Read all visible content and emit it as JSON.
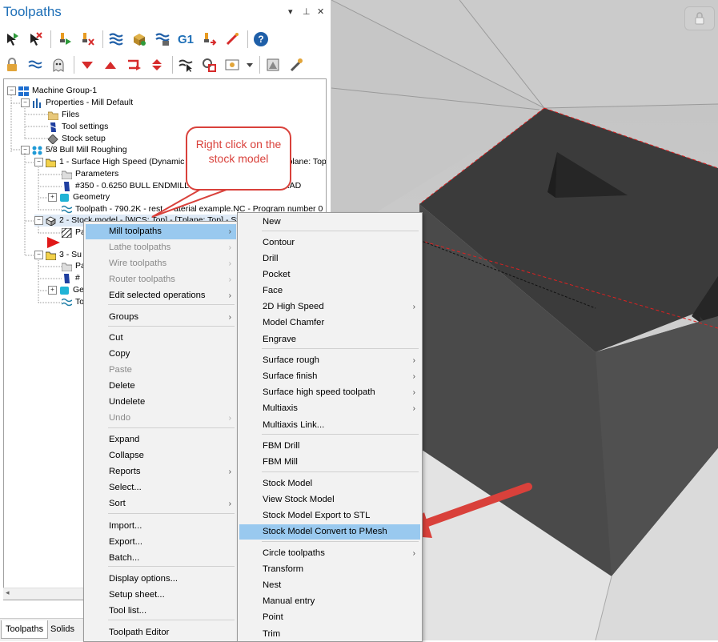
{
  "panel": {
    "title": "Toolpaths",
    "title_controls": [
      "▾",
      "⊥",
      "✕"
    ],
    "toolbar1_icons": [
      "select-all-icon",
      "deselect-icon",
      "regenerate-icon",
      "regenerate-dirty-icon",
      "backplot-icon",
      "verify-icon",
      "simulate-icon",
      "post-g1-icon",
      "post-selected-icon",
      "edit-tool-icon",
      "help-icon"
    ],
    "toolbar1_g1_label": "G1",
    "toolbar2_icons": [
      "lock-icon",
      "toggle-display-icon",
      "ghost-icon",
      "move-down-icon",
      "move-up-icon",
      "insert-arrow-icon",
      "move-updown-icon",
      "highlight-icon",
      "single-display-icon",
      "options-icon",
      "dropdown-icon",
      "verify-settings-icon",
      "wand-icon"
    ]
  },
  "tree": {
    "nodes": [
      {
        "text": "Machine Group-1"
      },
      {
        "text": "Properties - Mill Default"
      },
      {
        "text": "Files"
      },
      {
        "text": "Tool settings"
      },
      {
        "text": "Stock setup"
      },
      {
        "text": "5/8 Bull Mill Roughing"
      },
      {
        "text": "1 - Surface High Speed (Dynamic O"
      },
      {
        "text": "plane: Top]"
      },
      {
        "text": "Parameters"
      },
      {
        "text": "#350 - 0.6250 BULL ENDMILL - "
      },
      {
        "text": "RAD"
      },
      {
        "text": "Geometry"
      },
      {
        "text": "Toolpath - 790.2K - rest"
      },
      {
        "text": "aterial example.NC - Program number 0"
      },
      {
        "text": "2 - Stock model - [WCS: Top] - [Tplane: Top] - Sto"
      },
      {
        "text": "Pa"
      },
      {
        "text": "3 - Su"
      },
      {
        "text": "Pa"
      },
      {
        "text": "#"
      },
      {
        "text": "Ge"
      },
      {
        "text": "To"
      }
    ]
  },
  "tabs": [
    "Toolpaths",
    "Solids"
  ],
  "callout": {
    "text": "Right click on the stock model"
  },
  "context_menu": {
    "items": [
      {
        "label": "Mill toolpaths",
        "arrow": "›",
        "state": "highlight"
      },
      {
        "label": "Lathe toolpaths",
        "arrow": "›",
        "state": "disabled"
      },
      {
        "label": "Wire toolpaths",
        "arrow": "›",
        "state": "disabled"
      },
      {
        "label": "Router toolpaths",
        "arrow": "›",
        "state": "disabled"
      },
      {
        "label": "Edit selected operations",
        "arrow": "›",
        "state": "normal"
      },
      {
        "label": "Groups",
        "arrow": "›",
        "state": "normal"
      },
      {
        "label": "Cut",
        "arrow": "",
        "state": "normal"
      },
      {
        "label": "Copy",
        "arrow": "",
        "state": "normal"
      },
      {
        "label": "Paste",
        "arrow": "",
        "state": "disabled"
      },
      {
        "label": "Delete",
        "arrow": "",
        "state": "normal"
      },
      {
        "label": "Undelete",
        "arrow": "",
        "state": "normal"
      },
      {
        "label": "Undo",
        "arrow": "›",
        "state": "disabled"
      },
      {
        "label": "Expand",
        "arrow": "",
        "state": "normal"
      },
      {
        "label": "Collapse",
        "arrow": "",
        "state": "normal"
      },
      {
        "label": "Reports",
        "arrow": "›",
        "state": "normal"
      },
      {
        "label": "Select...",
        "arrow": "",
        "state": "normal"
      },
      {
        "label": "Sort",
        "arrow": "›",
        "state": "normal"
      },
      {
        "label": "Import...",
        "arrow": "",
        "state": "normal"
      },
      {
        "label": "Export...",
        "arrow": "",
        "state": "normal"
      },
      {
        "label": "Batch...",
        "arrow": "",
        "state": "normal"
      },
      {
        "label": "Display options...",
        "arrow": "",
        "state": "normal"
      },
      {
        "label": "Setup sheet...",
        "arrow": "",
        "state": "normal"
      },
      {
        "label": "Tool list...",
        "arrow": "",
        "state": "normal"
      },
      {
        "label": "Toolpath Editor",
        "arrow": "",
        "state": "normal"
      }
    ]
  },
  "submenu": {
    "items": [
      {
        "label": "New",
        "arrow": "",
        "state": "normal"
      },
      {
        "label": "Contour",
        "arrow": "",
        "state": "normal"
      },
      {
        "label": "Drill",
        "arrow": "",
        "state": "normal"
      },
      {
        "label": "Pocket",
        "arrow": "",
        "state": "normal"
      },
      {
        "label": "Face",
        "arrow": "",
        "state": "normal"
      },
      {
        "label": "2D High Speed",
        "arrow": "›",
        "state": "normal"
      },
      {
        "label": "Model Chamfer",
        "arrow": "",
        "state": "normal"
      },
      {
        "label": "Engrave",
        "arrow": "",
        "state": "normal"
      },
      {
        "label": "Surface rough",
        "arrow": "›",
        "state": "normal"
      },
      {
        "label": "Surface finish",
        "arrow": "›",
        "state": "normal"
      },
      {
        "label": "Surface high speed toolpath",
        "arrow": "›",
        "state": "normal"
      },
      {
        "label": "Multiaxis",
        "arrow": "›",
        "state": "normal"
      },
      {
        "label": "Multiaxis Link...",
        "arrow": "",
        "state": "normal"
      },
      {
        "label": "FBM Drill",
        "arrow": "",
        "state": "normal"
      },
      {
        "label": "FBM Mill",
        "arrow": "",
        "state": "normal"
      },
      {
        "label": "Stock Model",
        "arrow": "",
        "state": "normal"
      },
      {
        "label": "View Stock Model",
        "arrow": "",
        "state": "normal"
      },
      {
        "label": "Stock Model Export to STL",
        "arrow": "",
        "state": "normal"
      },
      {
        "label": "Stock Model Convert to PMesh",
        "arrow": "",
        "state": "highlight"
      },
      {
        "label": "Circle toolpaths",
        "arrow": "›",
        "state": "normal"
      },
      {
        "label": "Transform",
        "arrow": "",
        "state": "normal"
      },
      {
        "label": "Nest",
        "arrow": "",
        "state": "normal"
      },
      {
        "label": "Manual entry",
        "arrow": "",
        "state": "normal"
      },
      {
        "label": "Point",
        "arrow": "",
        "state": "normal"
      },
      {
        "label": "Trim",
        "arrow": "",
        "state": "normal"
      }
    ]
  },
  "colors": {
    "accent": "#1e6fb7",
    "highlight": "#99c9ef",
    "callout": "#d9413b",
    "model_face": "#4a4a4a",
    "model_top": "#3a3a3a"
  }
}
